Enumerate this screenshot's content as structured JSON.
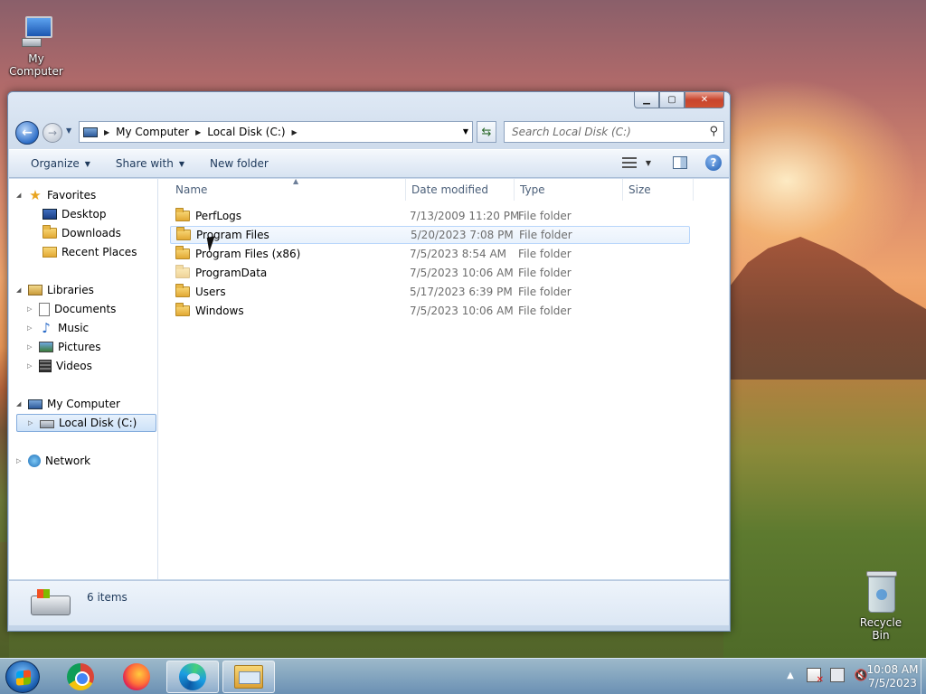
{
  "desktop": {
    "my_computer_label": "My Computer",
    "recycle_bin_label": "Recycle Bin"
  },
  "window": {
    "caption": {
      "minimize": "▁",
      "maximize": "▢",
      "close": "✕"
    },
    "address": {
      "segments": [
        "My Computer",
        "Local Disk (C:)"
      ]
    },
    "search": {
      "placeholder": "Search Local Disk (C:)"
    },
    "commands": {
      "organize": "Organize",
      "share_with": "Share with",
      "new_folder": "New folder"
    },
    "nav": {
      "favorites": "Favorites",
      "desktop": "Desktop",
      "downloads": "Downloads",
      "recent_places": "Recent Places",
      "libraries": "Libraries",
      "documents": "Documents",
      "music": "Music",
      "pictures": "Pictures",
      "videos": "Videos",
      "my_computer": "My Computer",
      "local_disk": "Local Disk (C:)",
      "network": "Network"
    },
    "columns": {
      "name": "Name",
      "date_modified": "Date modified",
      "type": "Type",
      "size": "Size"
    },
    "files": [
      {
        "name": "PerfLogs",
        "date": "7/13/2009 11:20 PM",
        "type": "File folder"
      },
      {
        "name": "Program Files",
        "date": "5/20/2023 7:08 PM",
        "type": "File folder"
      },
      {
        "name": "Program Files (x86)",
        "date": "7/5/2023 8:54 AM",
        "type": "File folder"
      },
      {
        "name": "ProgramData",
        "date": "7/5/2023 10:06 AM",
        "type": "File folder"
      },
      {
        "name": "Users",
        "date": "5/17/2023 6:39 PM",
        "type": "File folder"
      },
      {
        "name": "Windows",
        "date": "7/5/2023 10:06 AM",
        "type": "File folder"
      }
    ],
    "status": {
      "item_count": "6 items"
    }
  },
  "taskbar": {
    "clock_time": "10:08 AM",
    "clock_date": "7/5/2023",
    "tray_expand": "▲"
  }
}
